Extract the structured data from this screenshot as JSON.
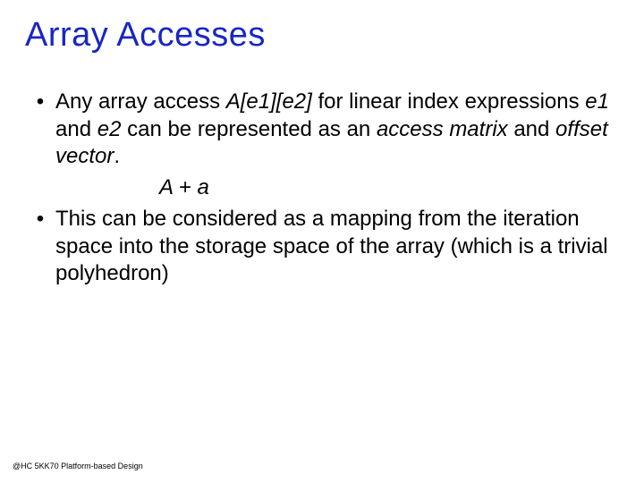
{
  "title": "Array Accesses",
  "bullets": {
    "b1": {
      "mark": "•",
      "seg1": "Any array access ",
      "expr": "A[e1][e2]",
      "seg2": " for linear index expressions ",
      "e1": "e1",
      "seg3": " and ",
      "e2": "e2",
      "seg4": " can be represented as an ",
      "am": "access matrix",
      "seg5": " and ",
      "ov": "offset vector",
      "seg6": "."
    },
    "formula": "A + a",
    "b2": {
      "mark": "•",
      "text": "This can be considered as a mapping from the iteration space into the storage space of the array (which is a trivial polyhedron)"
    }
  },
  "footer": "@HC 5KK70 Platform-based Design"
}
